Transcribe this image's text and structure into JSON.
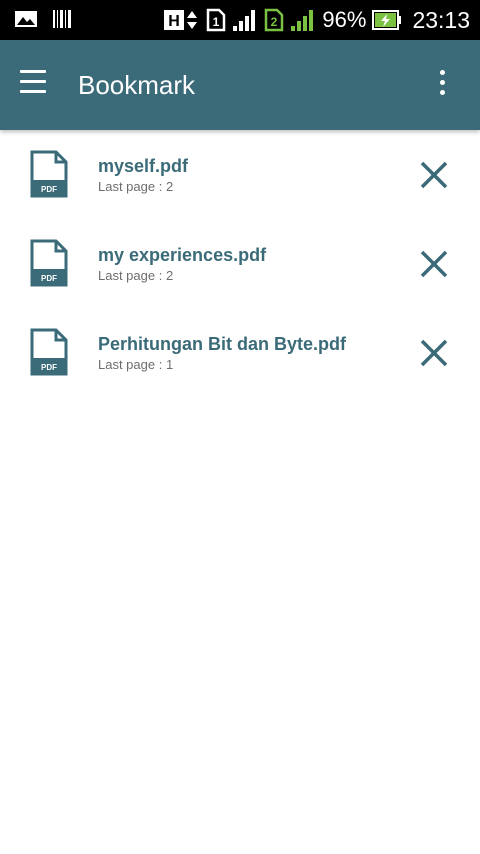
{
  "status_bar": {
    "battery": "96%",
    "time": "23:13",
    "sim1_label": "1",
    "sim2_label": "2",
    "network_type": "H"
  },
  "app_bar": {
    "title": "Bookmark"
  },
  "bookmarks": [
    {
      "file_name": "myself.pdf",
      "last_page": "Last page : 2",
      "icon_label": "PDF"
    },
    {
      "file_name": "my experiences.pdf",
      "last_page": "Last page : 2",
      "icon_label": "PDF"
    },
    {
      "file_name": "Perhitungan Bit dan Byte.pdf",
      "last_page": "Last page : 1",
      "icon_label": "PDF"
    }
  ],
  "colors": {
    "app_bar": "#3b6b78",
    "accent": "#3b6b78",
    "signal_sim2": "#7cc242"
  }
}
